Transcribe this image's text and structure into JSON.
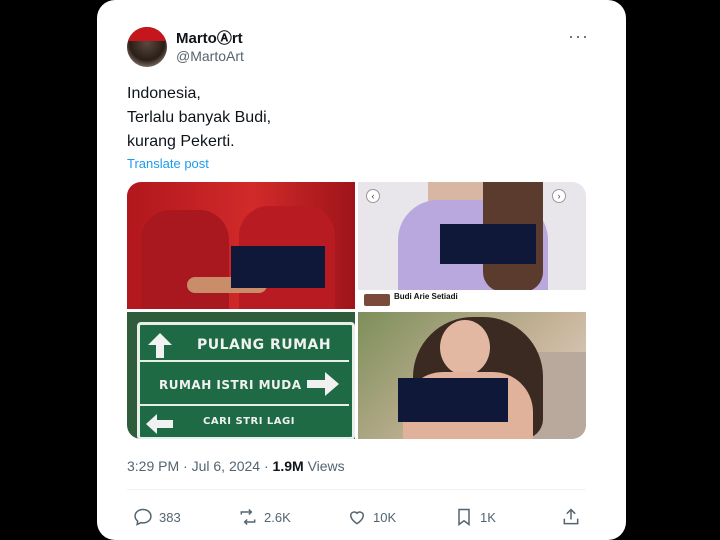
{
  "post": {
    "author_name": "MartoⒶrt",
    "handle": "@MartoArt",
    "more_icon": "···",
    "lines": [
      "Indonesia,",
      "Terlalu banyak Budi,",
      "kurang Pekerti."
    ],
    "translate_label": "Translate post",
    "time": "3:29 PM",
    "sep": " · ",
    "date": "Jul 6, 2024",
    "views_count": "1.9M",
    "views_label": "Views"
  },
  "media": {
    "fb_name": "Budi Arie Setiadi",
    "sign_line1": "PULANG RUMAH",
    "sign_line2": "RUMAH ISTRI MUDA",
    "sign_line3": "CARI STRI LAGI"
  },
  "actions": {
    "replies": "383",
    "reposts": "2.6K",
    "likes": "10K",
    "bookmarks": "1K"
  },
  "colors": {
    "link": "#1d9bf0",
    "secondary_text": "#536471",
    "censor": "#0f1838"
  }
}
